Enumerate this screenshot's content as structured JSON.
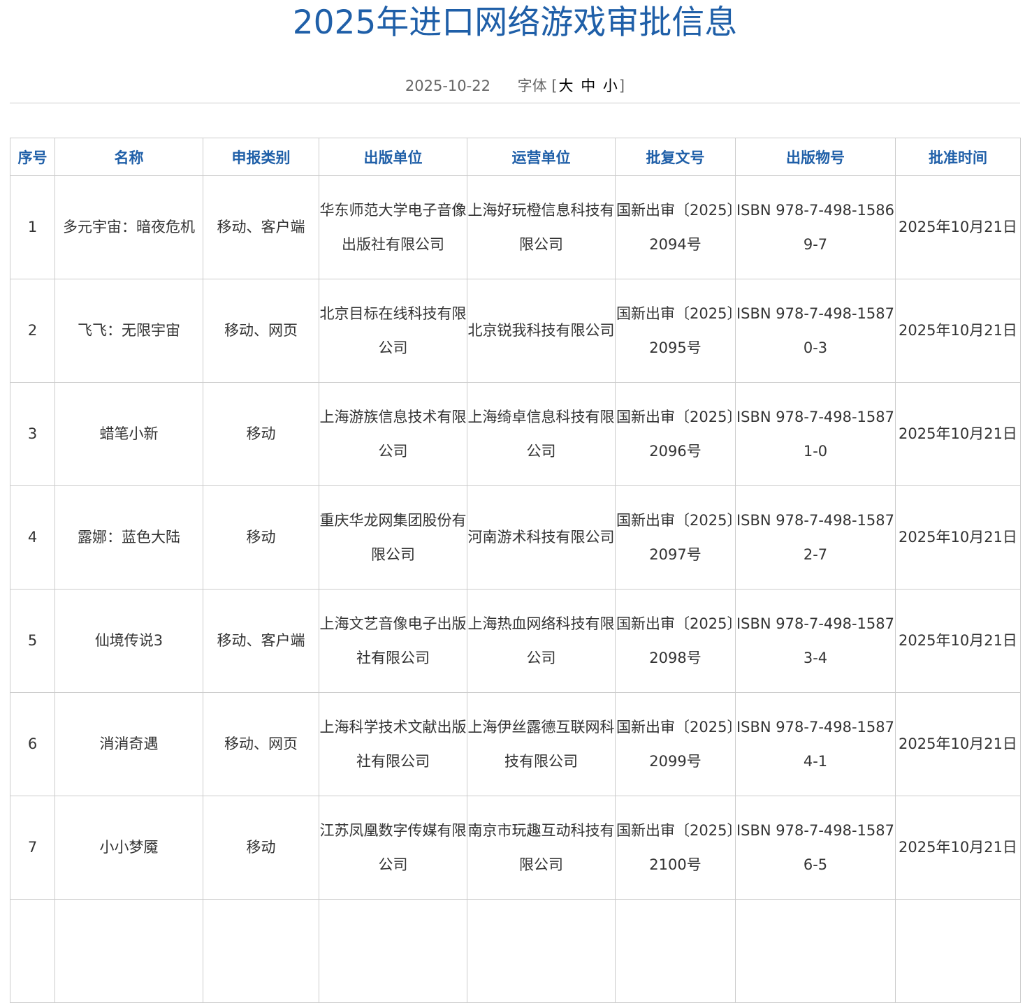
{
  "page": {
    "title": "2025年进口网络游戏审批信息",
    "date": "2025-10-22",
    "font_label": "字体",
    "bracket_open": "[",
    "bracket_close": "]",
    "font_sizes": [
      "大",
      "中",
      "小"
    ]
  },
  "colors": {
    "title": "#1f5fa8",
    "header_text": "#1f5fa8",
    "border": "#cccccc"
  },
  "table": {
    "headers": [
      "序号",
      "名称",
      "申报类别",
      "出版单位",
      "运营单位",
      "批复文号",
      "出版物号",
      "批准时间"
    ],
    "rows": [
      {
        "no": "1",
        "name": "多元宇宙：暗夜危机",
        "category": "移动、客户端",
        "publisher": "华东师范大学电子音像出版社有限公司",
        "operator": "上海好玩橙信息科技有限公司",
        "approval": "国新出审〔2025〕2094号",
        "isbn": "ISBN 978-7-498-15869-7",
        "date": "2025年10月21日"
      },
      {
        "no": "2",
        "name": "飞飞：无限宇宙",
        "category": "移动、网页",
        "publisher": "北京目标在线科技有限公司",
        "operator": "北京锐我科技有限公司",
        "approval": "国新出审〔2025〕2095号",
        "isbn": "ISBN 978-7-498-15870-3",
        "date": "2025年10月21日"
      },
      {
        "no": "3",
        "name": "蜡笔小新",
        "category": "移动",
        "publisher": "上海游族信息技术有限公司",
        "operator": "上海绮卓信息科技有限公司",
        "approval": "国新出审〔2025〕2096号",
        "isbn": "ISBN 978-7-498-15871-0",
        "date": "2025年10月21日"
      },
      {
        "no": "4",
        "name": "露娜：蓝色大陆",
        "category": "移动",
        "publisher": "重庆华龙网集团股份有限公司",
        "operator": "河南游术科技有限公司",
        "approval": "国新出审〔2025〕2097号",
        "isbn": "ISBN 978-7-498-15872-7",
        "date": "2025年10月21日"
      },
      {
        "no": "5",
        "name": "仙境传说3",
        "category": "移动、客户端",
        "publisher": "上海文艺音像电子出版社有限公司",
        "operator": "上海热血网络科技有限公司",
        "approval": "国新出审〔2025〕2098号",
        "isbn": "ISBN 978-7-498-15873-4",
        "date": "2025年10月21日"
      },
      {
        "no": "6",
        "name": "消消奇遇",
        "category": "移动、网页",
        "publisher": "上海科学技术文献出版社有限公司",
        "operator": "上海伊丝露德互联网科技有限公司",
        "approval": "国新出审〔2025〕2099号",
        "isbn": "ISBN 978-7-498-15874-1",
        "date": "2025年10月21日"
      },
      {
        "no": "7",
        "name": "小小梦魇",
        "category": "移动",
        "publisher": "江苏凤凰数字传媒有限公司",
        "operator": "南京市玩趣互动科技有限公司",
        "approval": "国新出审〔2025〕2100号",
        "isbn": "ISBN 978-7-498-15876-5",
        "date": "2025年10月21日"
      }
    ]
  }
}
